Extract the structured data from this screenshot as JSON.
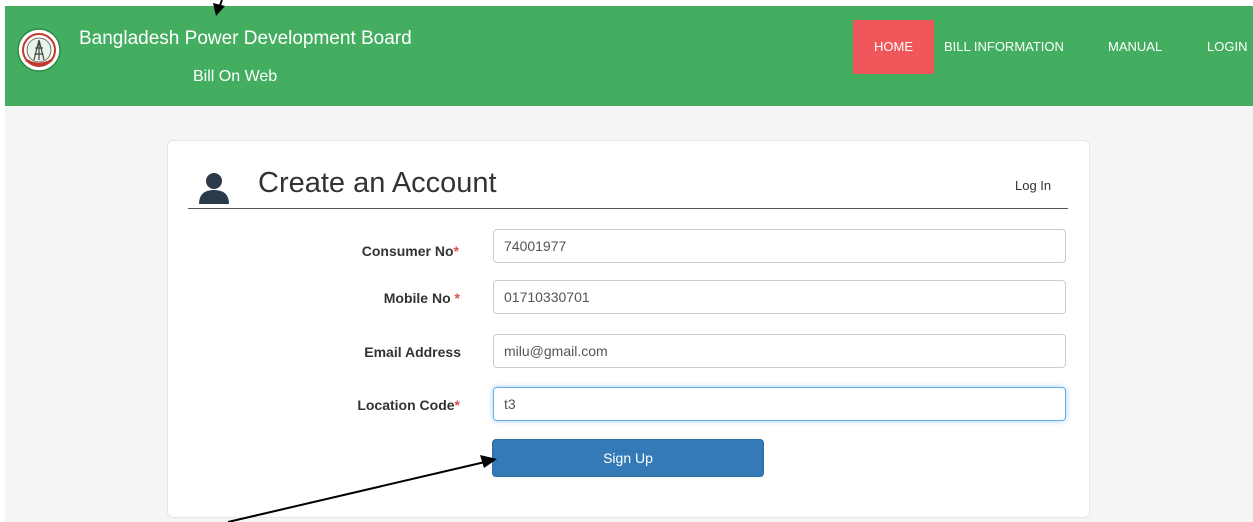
{
  "navbar": {
    "brand_title": "Bangladesh Power Development Board",
    "brand_subtitle": "Bill On Web",
    "items": [
      {
        "label": "HOME",
        "active": true
      },
      {
        "label": "BILL INFORMATION"
      },
      {
        "label": "MANUAL"
      },
      {
        "label": "LOGIN"
      }
    ],
    "background": "#43ae5f",
    "active_color": "#f0575b"
  },
  "form": {
    "title": "Create an Account",
    "login_link": "Log In",
    "required_mark": "*",
    "fields": [
      {
        "label": "Consumer No",
        "required": true,
        "value": "74001977"
      },
      {
        "label": "Mobile No ",
        "required": true,
        "value": "01710330701"
      },
      {
        "label": "Email Address",
        "required": false,
        "value": "milu@gmail.com"
      },
      {
        "label": "Location Code",
        "required": true,
        "value": "t3",
        "focused": true
      }
    ],
    "submit_label": "Sign Up",
    "submit_color": "#337ab7"
  },
  "icons": {
    "logo": "bpdb-logo-icon",
    "user": "user-icon"
  }
}
